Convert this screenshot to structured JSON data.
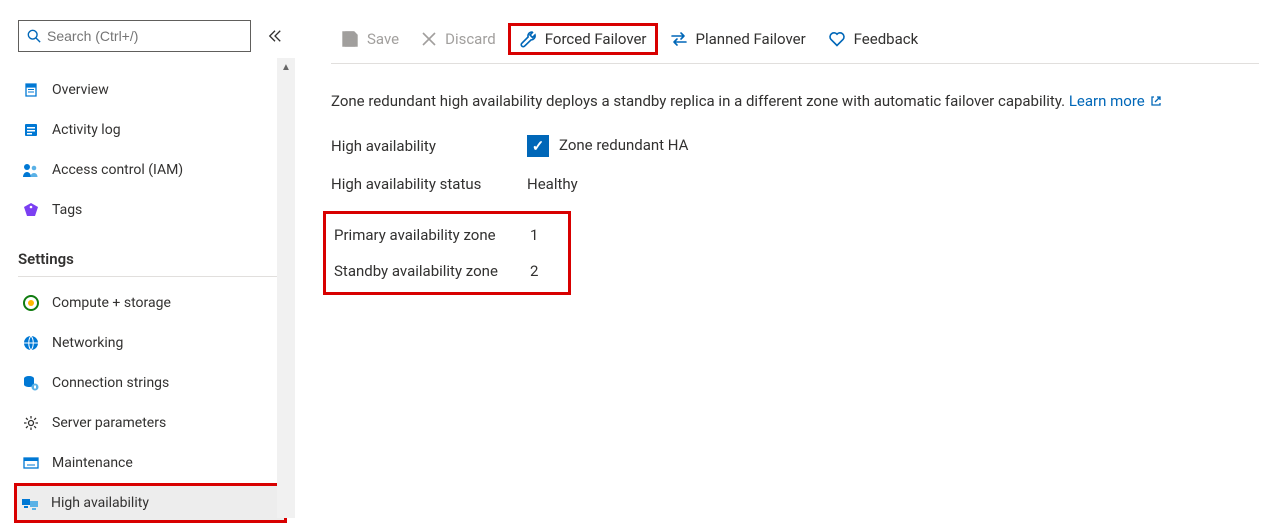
{
  "sidebar": {
    "search_placeholder": "Search (Ctrl+/)",
    "top_items": [
      {
        "icon": "overview",
        "label": "Overview"
      },
      {
        "icon": "log",
        "label": "Activity log"
      },
      {
        "icon": "iam",
        "label": "Access control (IAM)"
      },
      {
        "icon": "tags",
        "label": "Tags"
      }
    ],
    "settings_heading": "Settings",
    "settings_items": [
      {
        "icon": "compute",
        "label": "Compute + storage"
      },
      {
        "icon": "network",
        "label": "Networking"
      },
      {
        "icon": "connection",
        "label": "Connection strings"
      },
      {
        "icon": "gear",
        "label": "Server parameters"
      },
      {
        "icon": "maintenance",
        "label": "Maintenance"
      },
      {
        "icon": "ha",
        "label": "High availability",
        "selected": true,
        "highlighted": true
      }
    ]
  },
  "toolbar": {
    "save": "Save",
    "discard": "Discard",
    "forced": "Forced Failover",
    "planned": "Planned Failover",
    "feedback": "Feedback"
  },
  "content": {
    "intro_text": "Zone redundant high availability deploys a standby replica in a different zone with automatic failover capability.",
    "learn_more": "Learn more",
    "rows": {
      "ha_label": "High availability",
      "ha_checkbox_label": "Zone redundant HA",
      "status_label": "High availability status",
      "status_value": "Healthy",
      "primary_label": "Primary availability zone",
      "primary_value": "1",
      "standby_label": "Standby availability zone",
      "standby_value": "2"
    }
  }
}
